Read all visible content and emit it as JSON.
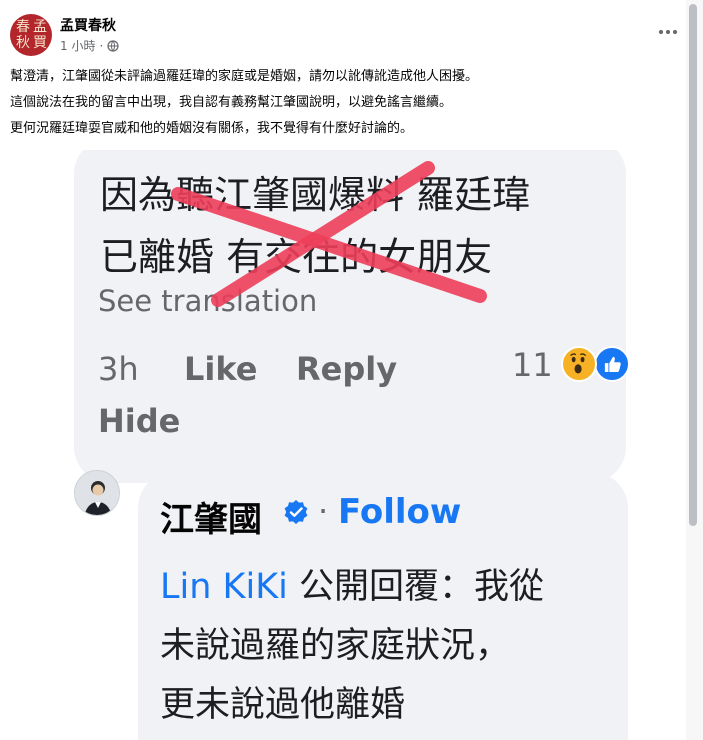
{
  "post": {
    "author": "孟買春秋",
    "avatar_text": [
      "春",
      "孟",
      "秋",
      "買"
    ],
    "time": "1 小時",
    "separator": "·",
    "lines": [
      "幫澄清，江肇國從未評論過羅廷瑋的家庭或是婚姻，請勿以訛傳訛造成他人困擾。",
      "這個說法在我的留言中出現，我自認有義務幫江肇國說明，以避免謠言繼續。",
      "更何況羅廷瑋耍官威和他的婚姻沒有關係，我不覺得有什麼好討論的。"
    ]
  },
  "screenshot": {
    "comment": {
      "line1": "因為聽江肇國爆料 羅廷瑋",
      "line2": "已離婚 有交往的女朋友",
      "see_translation": "See translation",
      "time": "3h",
      "like": "Like",
      "reply": "Reply",
      "reaction_count": "11",
      "hide": "Hide"
    },
    "reply": {
      "name": "江肇國",
      "dot": "·",
      "follow": "Follow",
      "mention": "Lin KiKi",
      "line1_rest": " 公開回覆：我從",
      "line2": "未說過羅的家庭狀況，",
      "line3": "更未說過他離婚"
    }
  },
  "icons": {
    "more": "more-options-icon",
    "globe": "globe-icon",
    "verified": "verified-badge-icon",
    "wow": "wow-reaction-icon",
    "like": "like-reaction-icon"
  },
  "colors": {
    "link_blue": "#1877f2",
    "red_x": "#ee3f5a",
    "bubble_bg": "#f0f2f5",
    "meta_gray": "#65676b"
  }
}
